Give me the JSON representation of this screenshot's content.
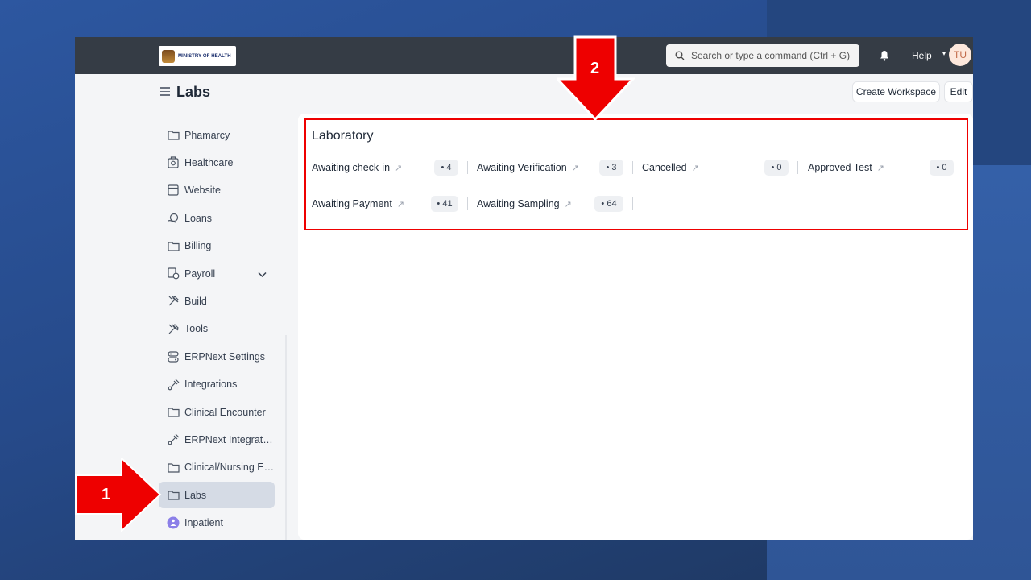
{
  "brand": {
    "logo_text": "MINISTRY OF HEALTH"
  },
  "navbar": {
    "search_placeholder": "Search or type a command (Ctrl + G)",
    "help_label": "Help",
    "avatar_initials": "TU"
  },
  "page": {
    "title": "Labs",
    "create_workspace_label": "Create Workspace",
    "edit_label": "Edit"
  },
  "sidebar": {
    "items": [
      {
        "label": "Phamarcy",
        "icon": "folder-icon"
      },
      {
        "label": "Healthcare",
        "icon": "healthcare-icon"
      },
      {
        "label": "Website",
        "icon": "website-icon"
      },
      {
        "label": "Loans",
        "icon": "loans-icon"
      },
      {
        "label": "Billing",
        "icon": "folder-icon"
      },
      {
        "label": "Payroll",
        "icon": "payroll-icon"
      },
      {
        "label": "Build",
        "icon": "tools-icon"
      },
      {
        "label": "Tools",
        "icon": "tools-icon"
      },
      {
        "label": "ERPNext Settings",
        "icon": "settings-toggle-icon"
      },
      {
        "label": "Integrations",
        "icon": "integration-icon"
      },
      {
        "label": "Clinical Encounter",
        "icon": "folder-icon"
      },
      {
        "label": "ERPNext Integratio...",
        "icon": "integration-icon"
      },
      {
        "label": "Clinical/Nursing En...",
        "icon": "folder-icon"
      },
      {
        "label": "Labs",
        "icon": "folder-icon"
      },
      {
        "label": "Inpatient",
        "icon": "inpatient-icon"
      }
    ]
  },
  "laboratory": {
    "title": "Laboratory",
    "shortcuts": [
      {
        "label": "Awaiting check-in",
        "count": "• 4"
      },
      {
        "label": "Awaiting Verification",
        "count": "• 3"
      },
      {
        "label": "Cancelled",
        "count": "• 0"
      },
      {
        "label": "Approved Test",
        "count": "• 0"
      },
      {
        "label": "Awaiting Payment",
        "count": "• 41"
      },
      {
        "label": "Awaiting Sampling",
        "count": "• 64"
      }
    ]
  },
  "annotations": {
    "marker_1": "1",
    "marker_2": "2"
  },
  "colors": {
    "navbar": "#353c45",
    "annotation_red": "#ee0000",
    "active_item": "#d5dbe5"
  }
}
